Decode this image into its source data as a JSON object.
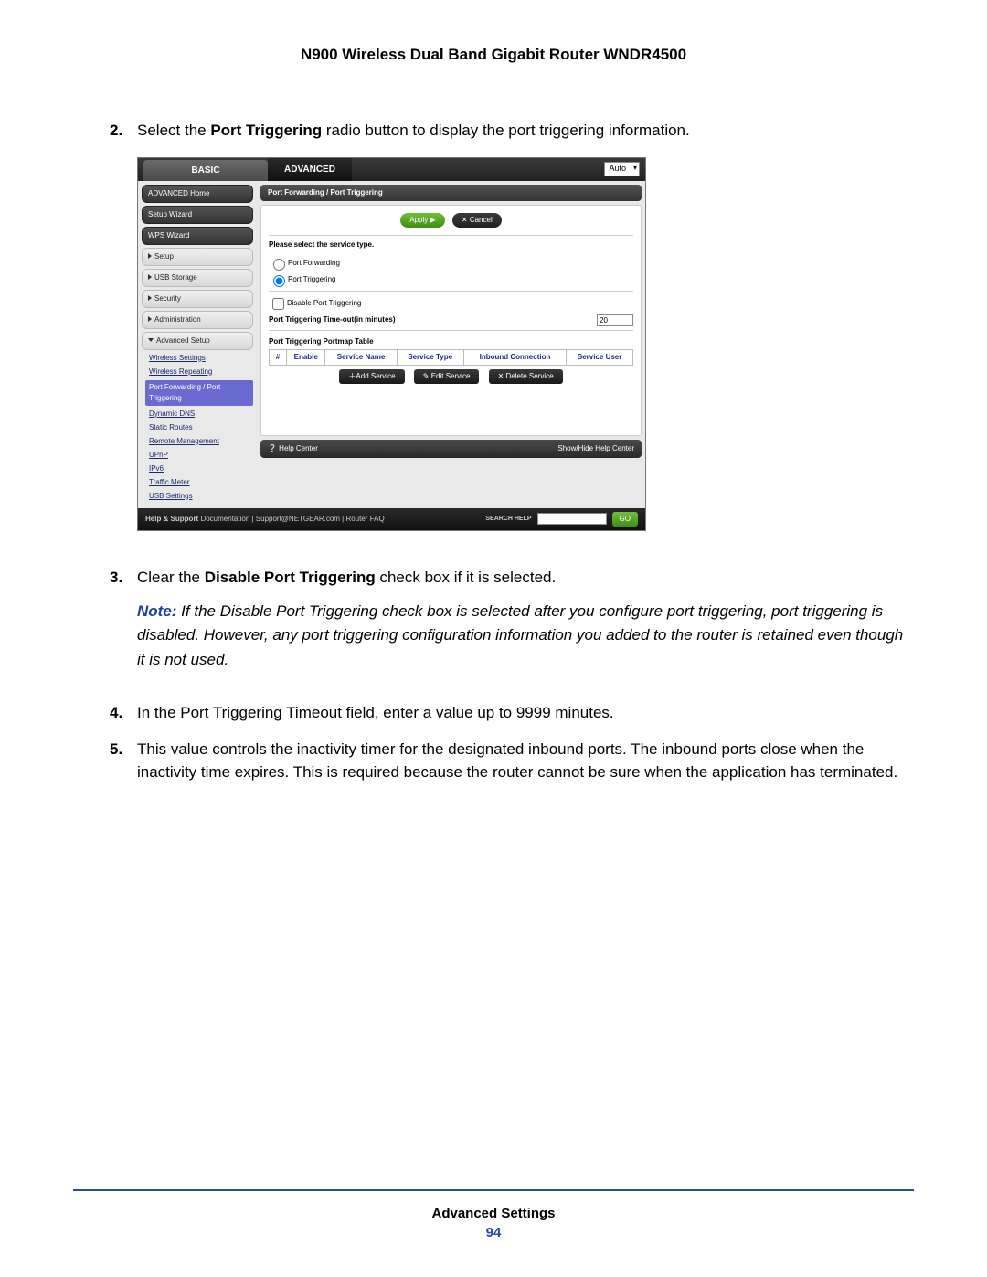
{
  "doc": {
    "title": "N900 Wireless Dual Band Gigabit Router WNDR4500",
    "footer_section": "Advanced Settings",
    "page_number": "94"
  },
  "steps": {
    "s2_pre": "Select the ",
    "s2_bold": "Port Triggering",
    "s2_post": " radio button to display the port triggering information.",
    "s3_pre": "Clear the ",
    "s3_bold": "Disable Port Triggering",
    "s3_post": " check box if it is selected.",
    "note_label": "Note:",
    "note_body": "  If the Disable Port Triggering check box is selected after you configure port triggering, port triggering is disabled. However, any port triggering configuration information you added to the router is retained even though it is not used.",
    "s4": "In the Port Triggering Timeout field, enter a value up to 9999 minutes.",
    "s5": "This value controls the inactivity timer for the designated inbound ports. The inbound ports close when the inactivity time expires. This is required because the router cannot be sure when the application has terminated."
  },
  "ui": {
    "tabs": {
      "basic": "BASIC",
      "advanced": "ADVANCED",
      "auto": "Auto"
    },
    "sidebar": {
      "buttons": [
        "ADVANCED Home",
        "Setup Wizard",
        "WPS Wizard"
      ],
      "sections": [
        "Setup",
        "USB Storage",
        "Security",
        "Administration"
      ],
      "adv_setup_label": "Advanced Setup",
      "subs": [
        "Wireless Settings",
        "Wireless Repeating",
        "Port Forwarding / Port Triggering",
        "Dynamic DNS",
        "Static Routes",
        "Remote Management",
        "UPnP",
        "IPv6",
        "Traffic Meter",
        "USB Settings"
      ]
    },
    "crumb": "Port Forwarding / Port Triggering",
    "apply": "Apply ▶",
    "cancel": "✕ Cancel",
    "service_prompt": "Please select the service type.",
    "radio_pf": "Port Forwarding",
    "radio_pt": "Port Triggering",
    "cb_disable": "Disable Port Triggering",
    "timeout_label": "Port Triggering Time-out(in minutes)",
    "timeout_value": "20",
    "portmap_title": "Port Triggering Portmap Table",
    "cols": [
      "#",
      "Enable",
      "Service Name",
      "Service Type",
      "Inbound Connection",
      "Service User"
    ],
    "btns": {
      "add": "＋Add Service",
      "edit": "✎ Edit Service",
      "del": "✕ Delete Service"
    },
    "help_center": "❔ Help Center",
    "help_toggle": "Show/Hide Help Center",
    "footer": {
      "label": "Help & Support",
      "links": "Documentation  |  Support@NETGEAR.com  |  Router FAQ",
      "search": "SEARCH HELP",
      "go": "GO"
    }
  }
}
